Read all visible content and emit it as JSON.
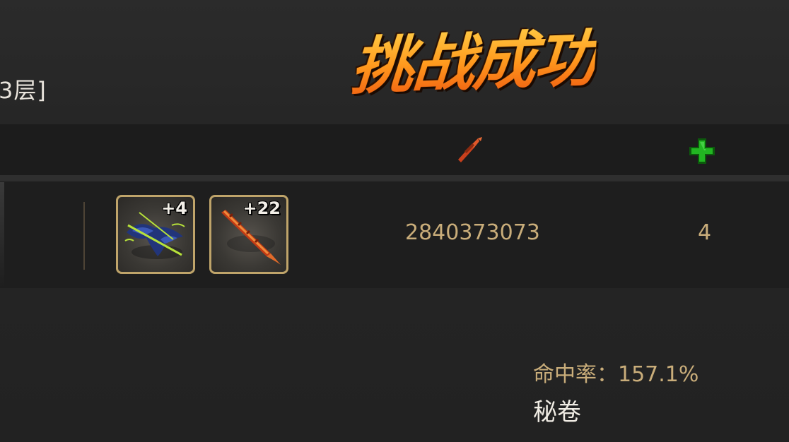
{
  "header": {
    "floor_label": "3层]",
    "banner_title": "挑战成功"
  },
  "table_header": {
    "col_power_icon": "sword-icon",
    "col_plus_icon": "plus-icon"
  },
  "row": {
    "items": [
      {
        "name": "crossbow-item",
        "level": "+4"
      },
      {
        "name": "spear-item",
        "level": "+22"
      }
    ],
    "power": "2840373073",
    "plus_count": "4"
  },
  "stats": {
    "hit_rate_label": "命中率：",
    "hit_rate_value": "157.1%",
    "secret_scroll_label": "秘卷"
  },
  "colors": {
    "banner_top": "#ffd24a",
    "banner_bottom": "#f05b10",
    "gold_text": "#c9ad7a",
    "slot_border": "#bfa46a",
    "plus_green": "#1fa51f",
    "sword_red": "#c8401c"
  }
}
